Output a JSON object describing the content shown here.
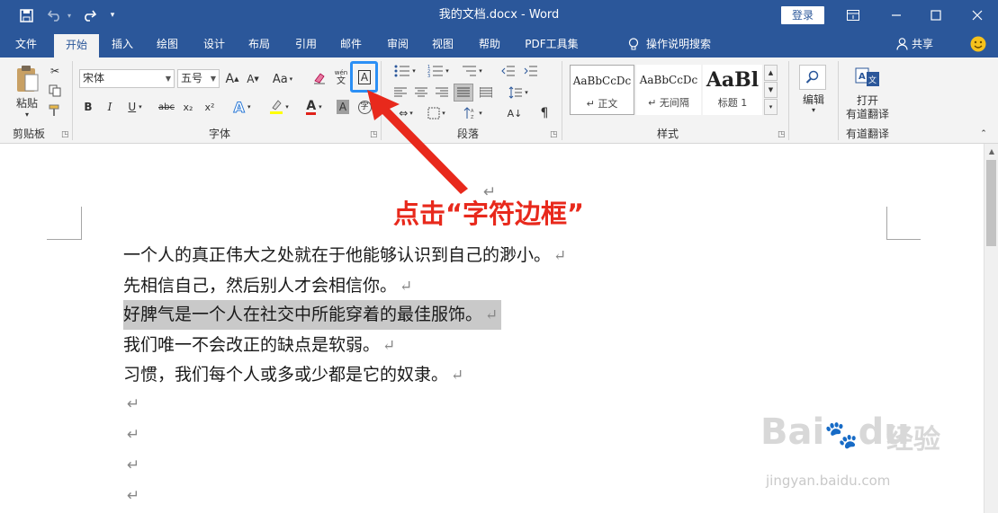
{
  "window": {
    "title": "我的文档.docx  -  Word",
    "login_label": "登录"
  },
  "tabs": [
    {
      "label": "文件"
    },
    {
      "label": "开始"
    },
    {
      "label": "插入"
    },
    {
      "label": "绘图"
    },
    {
      "label": "设计"
    },
    {
      "label": "布局"
    },
    {
      "label": "引用"
    },
    {
      "label": "邮件"
    },
    {
      "label": "审阅"
    },
    {
      "label": "视图"
    },
    {
      "label": "帮助"
    },
    {
      "label": "PDF工具集"
    }
  ],
  "tell_me": "操作说明搜索",
  "share_label": "共享",
  "ribbon": {
    "clipboard": {
      "paste_label": "粘贴",
      "group_label": "剪贴板"
    },
    "font": {
      "font_name": "宋体",
      "font_size": "五号",
      "group_label": "字体",
      "grow": "A",
      "shrink": "A",
      "case": "Aa",
      "bold": "B",
      "italic": "I",
      "underline": "U",
      "strike": "abc",
      "subscript": "x₂",
      "superscript": "x²",
      "char_border": "A",
      "phonetic_top": "wén",
      "phonetic_bottom": "文",
      "enclose": "字"
    },
    "paragraph": {
      "group_label": "段落"
    },
    "styles": {
      "group_label": "样式",
      "items": [
        {
          "sample": "AaBbCcDc",
          "name": "正文"
        },
        {
          "sample": "AaBbCcDc",
          "name": "无间隔"
        },
        {
          "sample": "AaBl",
          "name": "标题 1"
        }
      ]
    },
    "editing": {
      "label": "编辑"
    },
    "youdao": {
      "line1": "打开",
      "line2": "有道翻译",
      "group_label": "有道翻译"
    }
  },
  "document": {
    "lines": [
      "一个人的真正伟大之处就在于他能够认识到自己的渺小。",
      "先相信自己，然后别人才会相信你。",
      "好脾气是一个人在社交中所能穿着的最佳服饰。",
      "我们唯一不会改正的缺点是软弱。",
      "习惯，我们每个人或多或少都是它的奴隶。"
    ],
    "paragraph_mark": "↵"
  },
  "annotation": {
    "callout": "点击“字符边框”",
    "color": "#e8291c",
    "box_color": "#2b8ff5"
  },
  "watermark": {
    "brand": "Bai",
    "brand2": "du",
    "chinese": "经验",
    "url": "jingyan.baidu.com"
  },
  "colors": {
    "titlebar": "#2b579a",
    "ribbon": "#f3f3f3"
  }
}
